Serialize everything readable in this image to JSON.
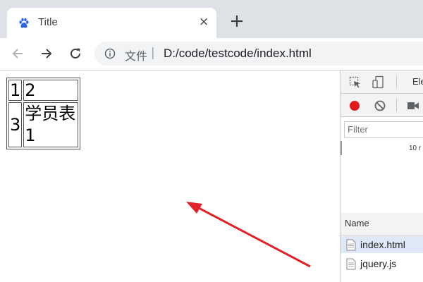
{
  "tab": {
    "title": "Title",
    "favicon": "baidu-paw-icon",
    "close_glyph": "×"
  },
  "newtab": {
    "icon": "plus-icon"
  },
  "toolbar": {
    "back_icon": "arrow-left-icon",
    "forward_icon": "arrow-right-icon",
    "reload_icon": "reload-icon"
  },
  "address": {
    "label": "文件",
    "separator": "|",
    "url": "D:/code/testcode/index.html",
    "icon": "info-icon"
  },
  "page": {
    "table": [
      [
        "1",
        "2"
      ],
      [
        "3",
        "学员表1"
      ]
    ]
  },
  "annotation": {
    "color": "#e0232b"
  },
  "devtools": {
    "tabs_partial": "Ele",
    "filter_placeholder": "Filter",
    "timeline_tick": "10 r",
    "record_color": "#e21a1a",
    "column_header": "Name",
    "files": [
      {
        "name": "index.html",
        "selected": true
      },
      {
        "name": "jquery.js",
        "selected": false
      }
    ]
  }
}
